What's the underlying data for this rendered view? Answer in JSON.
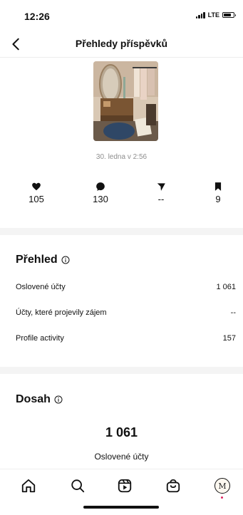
{
  "status_bar": {
    "time": "12:26",
    "network": "LTE",
    "battery_level": 0.8
  },
  "header": {
    "title": "Přehledy příspěvků",
    "back_icon": "chevron-left-icon"
  },
  "post": {
    "date": "30. ledna v 2:56"
  },
  "stats": [
    {
      "icon": "heart-icon",
      "value": "105"
    },
    {
      "icon": "comment-icon",
      "value": "130"
    },
    {
      "icon": "share-icon",
      "value": "--"
    },
    {
      "icon": "bookmark-icon",
      "value": "9"
    }
  ],
  "overview": {
    "title": "Přehled",
    "rows": [
      {
        "label": "Oslovené účty",
        "value": "1 061"
      },
      {
        "label": "Účty, které projevily zájem",
        "value": "--"
      },
      {
        "label": "Profile activity",
        "value": "157"
      }
    ]
  },
  "reach": {
    "title": "Dosah",
    "value": "1 061",
    "label": "Oslovené účty"
  },
  "bottom_nav": {
    "items": [
      "home-icon",
      "search-icon",
      "reels-icon",
      "shop-icon",
      "profile-avatar"
    ],
    "avatar_letter": "M"
  },
  "colors": {
    "accent_dot": "#e0245e",
    "muted_text": "#8e8e8e",
    "separator": "#f4f4f4"
  }
}
